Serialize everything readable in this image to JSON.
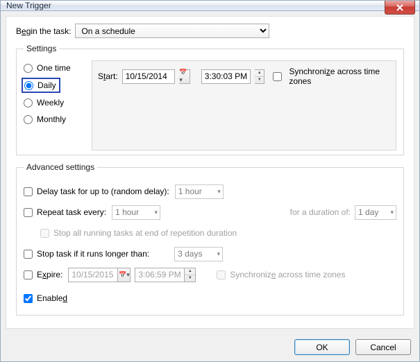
{
  "window": {
    "title": "New Trigger",
    "close": "X"
  },
  "begin": {
    "label_pre": "B",
    "label_u": "e",
    "label_post": "gin the task:",
    "value": "On a schedule"
  },
  "settings": {
    "legend": "Settings",
    "radios": {
      "one_time": "One time",
      "daily": "Daily",
      "weekly": "Weekly",
      "monthly": "Monthly"
    },
    "start_pre": "S",
    "start_u": "t",
    "start_post": "art:",
    "date": "10/15/2014",
    "time": "3:30:03 PM",
    "sync_pre": "Synchroni",
    "sync_u": "z",
    "sync_post": "e across time zones"
  },
  "advanced": {
    "legend": "Advanced settings",
    "delay_pre": "Delay task for up to (random delay):",
    "delay_value": "1 hour",
    "repeat_pre": "Repeat task every:",
    "repeat_value": "1 hour",
    "duration_pre": "for a duration of:",
    "duration_value": "1 day",
    "stop_all": "Stop all running tasks at end of repetition duration",
    "stop_if_pre": "Stop task if it runs longer than:",
    "stop_if_value": "3 days",
    "expire_pre": "E",
    "expire_u": "x",
    "expire_post": "pire:",
    "expire_date": "10/15/2015",
    "expire_time": "3:06:59 PM",
    "sync2_pre": "Synchroniz",
    "sync2_u": "e",
    "sync2_post": " across time zones",
    "enabled_pre": "Enable",
    "enabled_u": "d"
  },
  "buttons": {
    "ok": "OK",
    "cancel": "Cancel"
  }
}
